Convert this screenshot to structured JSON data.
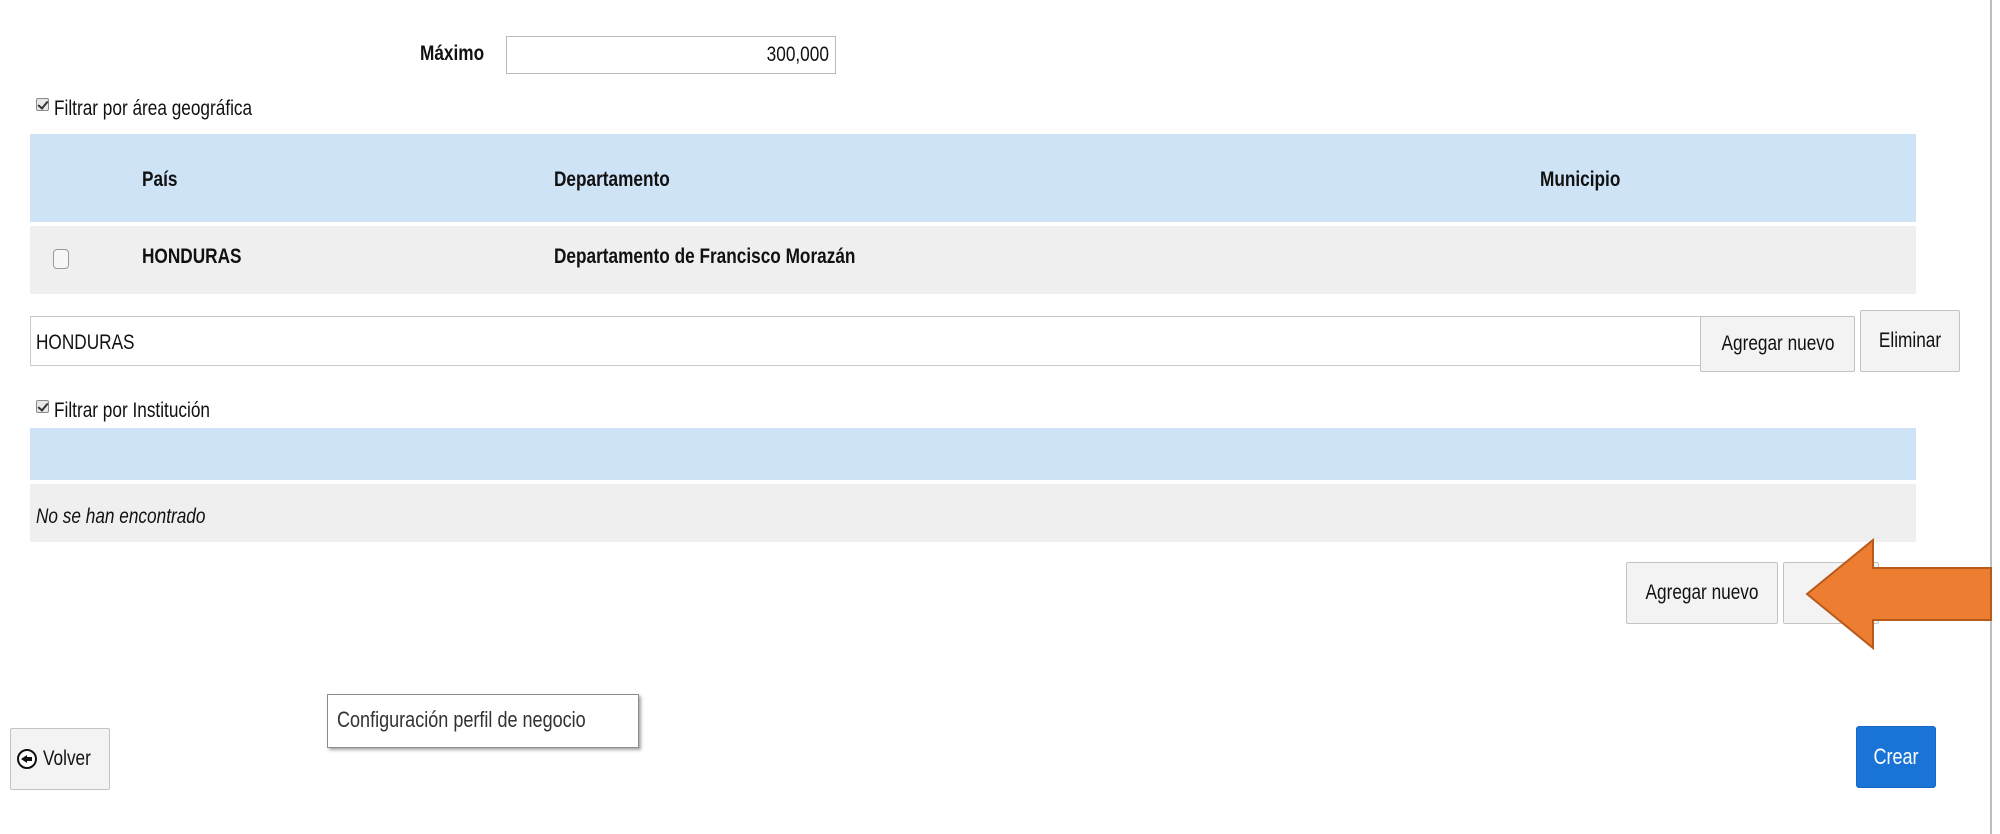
{
  "maximo": {
    "label": "Máximo",
    "value": "300,000"
  },
  "geo_filter": {
    "label": "Filtrar por área geográfica",
    "checked": true,
    "columns": [
      "País",
      "Departamento",
      "Municipio"
    ],
    "rows": [
      {
        "pais": "HONDURAS",
        "departamento": "Departamento de Francisco Morazán",
        "municipio": ""
      }
    ],
    "select_value": "HONDURAS",
    "add_label": "Agregar nuevo",
    "delete_label": "Eliminar"
  },
  "institution_filter": {
    "label": "Filtrar por Institución",
    "checked": true,
    "empty_message": "No se han encontrado",
    "add_label": "Agregar nuevo"
  },
  "tooltip": {
    "text": "Configuración perfil de negocio"
  },
  "footer": {
    "back_label": "Volver",
    "create_label": "Crear"
  },
  "colors": {
    "table_header": "#cfe3f7",
    "table_row": "#efefef",
    "primary_button": "#1a74d8",
    "annotation_arrow": "#ed7d31"
  },
  "icons": {
    "back": "arrow-circle-left-icon",
    "select": "dropdown-arrow-icon",
    "annotation": "left-arrow-annotation"
  }
}
